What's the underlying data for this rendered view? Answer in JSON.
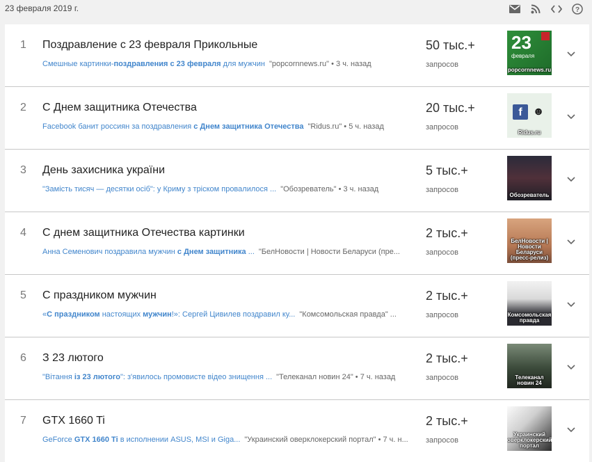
{
  "header": {
    "date": "23 февраля 2019 г.",
    "icons": [
      "mail-icon",
      "rss-icon",
      "embed-code-icon",
      "help-icon"
    ]
  },
  "count_label": "запросов",
  "colors": {
    "link": "#4286cc",
    "background": "#f1f1f1",
    "divider": "#c7c7c7"
  },
  "trends": [
    {
      "rank": "1",
      "title": "Поздравление с 23 февраля Прикольные",
      "article_parts": [
        {
          "t": "Смешные картинки-",
          "b": false
        },
        {
          "t": "поздравления с 23 февраля",
          "b": true
        },
        {
          "t": " для мужчин",
          "b": false
        }
      ],
      "source": "\"popcornnews.ru\" • 3 ч. назад",
      "count": "50 тыс.+",
      "thumb_caption": "popcornnews.ru",
      "thumb_text": "23",
      "thumb_small": "февраля"
    },
    {
      "rank": "2",
      "title": "С Днем защитника Отечества",
      "article_parts": [
        {
          "t": "Facebook банит россиян за поздравления ",
          "b": false
        },
        {
          "t": "с Днем защитника Отечества",
          "b": true
        }
      ],
      "source": "\"Ridus.ru\" • 5 ч. назад",
      "count": "20 тыс.+",
      "thumb_caption": "Ridus.ru"
    },
    {
      "rank": "3",
      "title": "День захисника україни",
      "article_parts": [
        {
          "t": "\"Замість тисяч — десятки осіб\": у Криму з тріском провалилося ...",
          "b": false
        }
      ],
      "source": "\"Обозреватель\" • 3 ч. назад",
      "count": "5 тыс.+",
      "thumb_caption": "Обозреватель"
    },
    {
      "rank": "4",
      "title": "С днем защитника Отечества картинки",
      "article_parts": [
        {
          "t": "Анна Семенович поздравила мужчин ",
          "b": false
        },
        {
          "t": "с Днем защитника",
          "b": true
        },
        {
          "t": " ...",
          "b": false
        }
      ],
      "source": "\"БелНовости | Новости Беларуси (пре...",
      "count": "2 тыс.+",
      "thumb_caption": "БелНовости | Новости Беларуси (пресс-релиз)"
    },
    {
      "rank": "5",
      "title": "С праздником мужчин",
      "article_parts": [
        {
          "t": "«",
          "b": false
        },
        {
          "t": "С праздником",
          "b": true
        },
        {
          "t": " настоящих ",
          "b": false
        },
        {
          "t": "мужчин",
          "b": true
        },
        {
          "t": "!»: Сергей Цивилев поздравил ку...",
          "b": false
        }
      ],
      "source": "\"Комсомольская правда\" ...",
      "count": "2 тыс.+",
      "thumb_caption": "Комсомольская правда"
    },
    {
      "rank": "6",
      "title": "З 23 лютого",
      "article_parts": [
        {
          "t": "\"Вітання ",
          "b": false
        },
        {
          "t": "із 23 лютого",
          "b": true
        },
        {
          "t": "\": з'явилось промовисте відео знищення ...",
          "b": false
        }
      ],
      "source": "\"Телеканал новин 24\" • 7 ч. назад",
      "count": "2 тыс.+",
      "thumb_caption": "Телеканал новин 24"
    },
    {
      "rank": "7",
      "title": "GTX 1660 Ti",
      "article_parts": [
        {
          "t": "GeForce ",
          "b": false
        },
        {
          "t": "GTX 1660 Ti",
          "b": true
        },
        {
          "t": " в исполнении ASUS, MSI и Giga...",
          "b": false
        }
      ],
      "source": "\"Украинский оверклокерский портал\" • 7 ч. н...",
      "count": "2 тыс.+",
      "thumb_caption": "Украинский оверклокерский портал"
    }
  ]
}
